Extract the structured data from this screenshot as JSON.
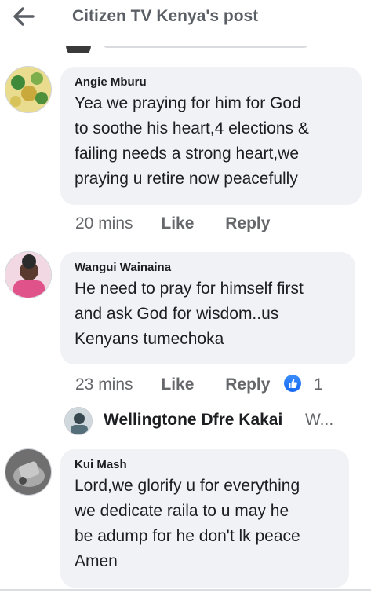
{
  "header": {
    "title": "Citizen TV Kenya's post",
    "back_icon": "arrow-left-icon"
  },
  "comments": [
    {
      "author": "Angie Mburu",
      "lines": [
        "Yea we praying for him for God",
        "to soothe his heart,4 elections &",
        "failing needs a strong heart,we",
        "praying u retire now peacefully"
      ],
      "time": "20 mins",
      "like_label": "Like",
      "reply_label": "Reply"
    },
    {
      "author": "Wangui Wainaina",
      "lines": [
        "He need to pray for himself first",
        "and ask God for wisdom..us",
        "Kenyans tumechoka"
      ],
      "time": "23 mins",
      "like_label": "Like",
      "reply_label": "Reply",
      "reaction_count": "1",
      "reaction_icon": "thumbs-up-icon"
    },
    {
      "author": "Kui Mash",
      "lines": [
        "Lord,we glorify u for everything",
        "we dedicate raila to u may he",
        "be adump for he don't lk peace",
        "Amen"
      ]
    }
  ],
  "reply_preview": {
    "name": "Wellingtone Dfre Kakai",
    "snippet": "W..."
  },
  "colors": {
    "bubble": "#f0f2f5",
    "meta_text": "#65676b",
    "like_blue": "#1877f2"
  }
}
